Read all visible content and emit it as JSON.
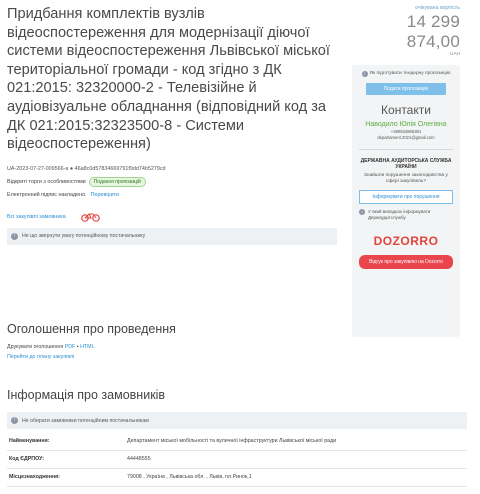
{
  "tender": {
    "title": "Придбання комплектів вузлів відеоспостереження для модернізації діючої системи відеоспостереження Львівської міської територіальної громади - код згідно з ДК 021:2015: 32320000-2 - Телевізійне й аудіовізуальне обладнання (відповідний код за ДК 021:2015:32323500-8 - Системи відеоспостереження)",
    "id_line": "UA-2023-07-27-009566-a ● 46a8c0d57834669791f9dd74b5279cd",
    "procedure_type": "Відкриті торги з особливостями",
    "status_badge": "Подання пропозицій",
    "signature_label": "Електронний підпис накладено.",
    "signature_link": "Перевірити",
    "all_tenders_link": "Всі закупівлі замовника",
    "notify_text": "Не що звернути увагу потенційному постачальнику"
  },
  "price": {
    "label": "очікувана вартість",
    "amount": "14 299 874,00",
    "currency": "UAH"
  },
  "sidebar": {
    "participation_note": "Як підготувати тендерну пропозицію",
    "submit_button": "Подати пропозицію",
    "contacts_heading": "Контакти",
    "contact_name": "Наводило Юлія Олегівна",
    "contact_phone": "+380634866381",
    "contact_email": "departament.2021@gmail.com",
    "audit_heading": "ДЕРЖАВНА АУДИТОРСЬКА СЛУЖБА УКРАЇНИ",
    "audit_question": "Знайшли порушення законодавства у сфері закупівель?",
    "inform_button": "Інформувати про порушення",
    "audit_note": "У який випадках інформувати Держаудитслужбу",
    "dozorro_logo": "DOZORRO",
    "dozorro_button": "Відгук про закупівлю на Dozorro"
  },
  "announcement": {
    "heading": "Оголошення про проведення",
    "print_label": "Друкувати оголошення",
    "print_pdf": "PDF",
    "print_html": "HTML",
    "plan_link": "Перейти до плану закупівлі"
  },
  "customer": {
    "heading": "Інформація про замовників",
    "strip_text": "Не обирати замовники потенційним постачальникам",
    "rows": [
      {
        "key": "Найменування:",
        "value": "Департамент міської мобільності та вуличної інфраструктури Львівської міської ради"
      },
      {
        "key": "Код ЄДРПОУ:",
        "value": "44448555"
      },
      {
        "key": "Місцезнаходження:",
        "value": "79008 , Україна , Львівська обл. , Львів, пл.Ринок,1"
      }
    ]
  },
  "colors": {
    "link": "#2e8fd4",
    "status_green": "#2f7a1f",
    "submit_blue": "#7ec0ea",
    "dozorro_red": "#e8454d"
  },
  "icons": [
    "info-icon",
    "bicycle-icon",
    "dozorro-logo"
  ]
}
